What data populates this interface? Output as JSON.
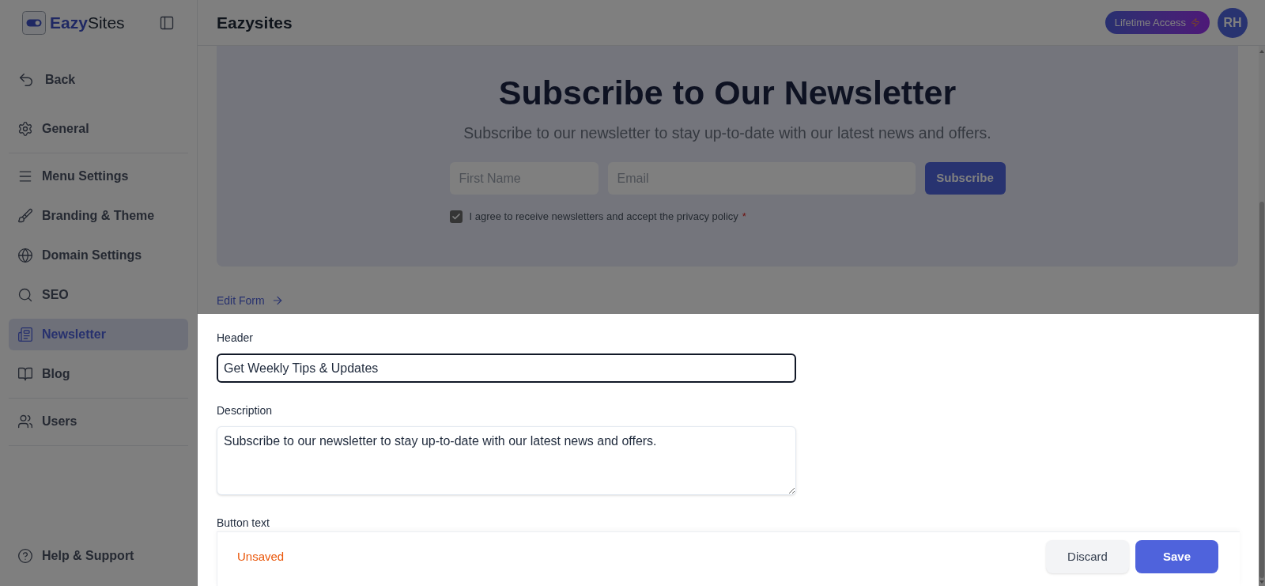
{
  "sidebar": {
    "brand": "**Eazy**Sites",
    "items": [
      {
        "label": "Back",
        "kind": "back",
        "selected": false,
        "divider_after": false
      },
      {
        "label": "General",
        "kind": "general",
        "selected": false,
        "divider_after": true
      },
      {
        "label": "Menu Settings",
        "kind": "menu",
        "selected": false,
        "divider_after": false
      },
      {
        "label": "Branding & Theme",
        "kind": "branding",
        "selected": false,
        "divider_after": false
      },
      {
        "label": "Domain Settings",
        "kind": "domain",
        "selected": false,
        "divider_after": false
      },
      {
        "label": "SEO",
        "kind": "seo",
        "selected": false,
        "divider_after": false
      },
      {
        "label": "Newsletter",
        "kind": "newsletter",
        "selected": true,
        "divider_after": false
      },
      {
        "label": "Blog",
        "kind": "blog",
        "selected": false,
        "divider_after": true
      },
      {
        "label": "Users",
        "kind": "users",
        "selected": false,
        "divider_after": true
      }
    ],
    "bottom_items": [
      {
        "label": "Help & Support",
        "kind": "help",
        "selected": false
      }
    ]
  },
  "topbar": {
    "title": "Eazysites",
    "plan_badge": "Lifetime Access",
    "avatar_initials": "RH"
  },
  "preview": {
    "title": "Subscribe to Our Newsletter",
    "subtitle": "Subscribe to our newsletter to stay up-to-date with our latest news and offers.",
    "fields": [
      {
        "placeholder": "First Name"
      },
      {
        "placeholder": "Email"
      }
    ],
    "button": "Subscribe",
    "consent": {
      "label": "I agree to receive newsletters and accept the privacy policy",
      "required_mark": "*",
      "checked": true
    }
  },
  "edit_form_link": "Edit Form",
  "sheet": {
    "fields": [
      {
        "label": "Header",
        "kind": "input",
        "value": "Get Weekly Tips & Updates",
        "focused": true
      },
      {
        "label": "Description",
        "kind": "textarea",
        "value": "Subscribe to our newsletter to stay up-to-date with our latest news and offers.",
        "focused": false
      }
    ],
    "next_field_label": "Button text",
    "footer": {
      "status": "Unsaved",
      "buttons": [
        {
          "label": "Discard",
          "kind": "secondary"
        },
        {
          "label": "Save",
          "kind": "primary"
        }
      ]
    }
  }
}
